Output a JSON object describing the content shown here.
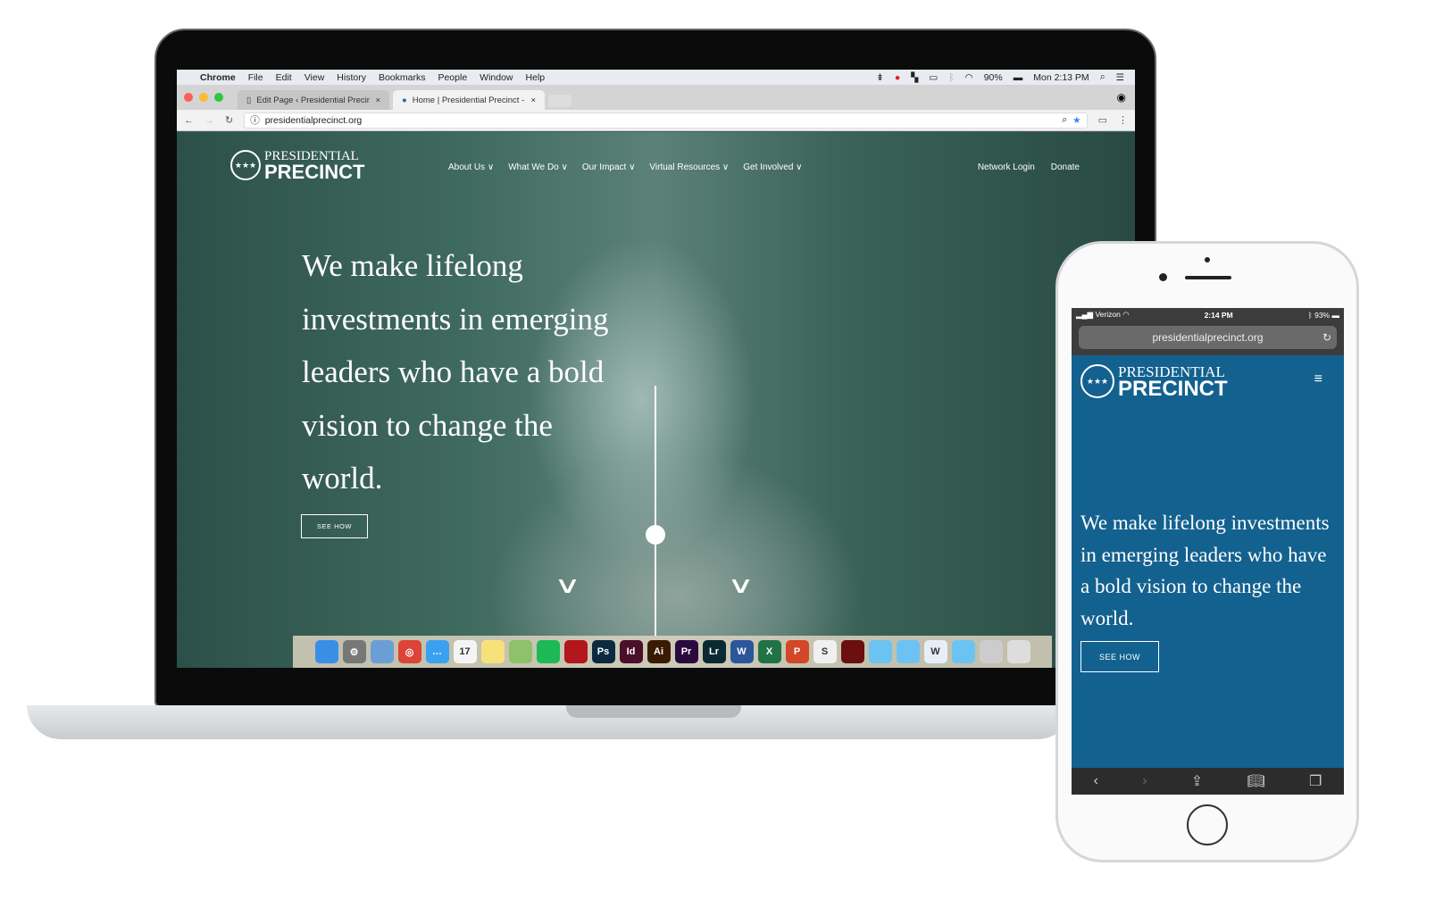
{
  "mac_menubar": {
    "apple": "",
    "items": [
      "Chrome",
      "File",
      "Edit",
      "View",
      "History",
      "Bookmarks",
      "People",
      "Window",
      "Help"
    ],
    "battery": "90%",
    "clock": "Mon 2:13 PM"
  },
  "browser": {
    "tabs": [
      {
        "label": "Edit Page ‹ Presidential Precinct",
        "active": false
      },
      {
        "label": "Home | Presidential Precinct -",
        "active": true
      }
    ],
    "url": "presidentialprecinct.org"
  },
  "site": {
    "logo": {
      "line1": "PRESIDENTIAL",
      "line2": "PRECINCT"
    },
    "nav": [
      "About Us ∨",
      "What We Do ∨",
      "Our Impact ∨",
      "Virtual Resources ∨",
      "Get Involved ∨"
    ],
    "nav_right": [
      "Network Login",
      "Donate"
    ],
    "headline": "We make lifelong investments in emerging leaders who have a bold vision to change the world.",
    "cta": "SEE HOW"
  },
  "dock": [
    {
      "label": "",
      "color": "#3a8ee6"
    },
    {
      "label": "⚙",
      "color": "#777"
    },
    {
      "label": "",
      "color": "#6a9fd6"
    },
    {
      "label": "◎",
      "color": "#db4437"
    },
    {
      "label": "…",
      "color": "#3aa0f0"
    },
    {
      "label": "17",
      "color": "#f4f4f4"
    },
    {
      "label": "",
      "color": "#f7e27a"
    },
    {
      "label": "",
      "color": "#8fc06a"
    },
    {
      "label": "",
      "color": "#1db954"
    },
    {
      "label": "",
      "color": "#b3161b"
    },
    {
      "label": "Ps",
      "color": "#0b2a40"
    },
    {
      "label": "Id",
      "color": "#4a0f2b"
    },
    {
      "label": "Ai",
      "color": "#3a1a00"
    },
    {
      "label": "Pr",
      "color": "#2a0a3e"
    },
    {
      "label": "Lr",
      "color": "#0a2a33"
    },
    {
      "label": "W",
      "color": "#2b579a"
    },
    {
      "label": "X",
      "color": "#217346"
    },
    {
      "label": "P",
      "color": "#d24726"
    },
    {
      "label": "S",
      "color": "#f0f0f0"
    },
    {
      "label": "",
      "color": "#6b0f0f"
    },
    {
      "label": "",
      "color": "#6cc3f2"
    },
    {
      "label": "",
      "color": "#6cc3f2"
    },
    {
      "label": "W",
      "color": "#e7eef8"
    },
    {
      "label": "",
      "color": "#6cc3f2"
    },
    {
      "label": "",
      "color": "#ccc"
    },
    {
      "label": "",
      "color": "#ddd"
    }
  ],
  "phone": {
    "carrier": "Verizon",
    "time": "2:14 PM",
    "battery": "93%",
    "url": "presidentialprecinct.org",
    "logo": {
      "line1": "PRESIDENTIAL",
      "line2": "PRECINCT"
    },
    "headline": "We make lifelong investments in emerging leaders who have a bold vision to change the world.",
    "cta": "SEE HOW"
  }
}
